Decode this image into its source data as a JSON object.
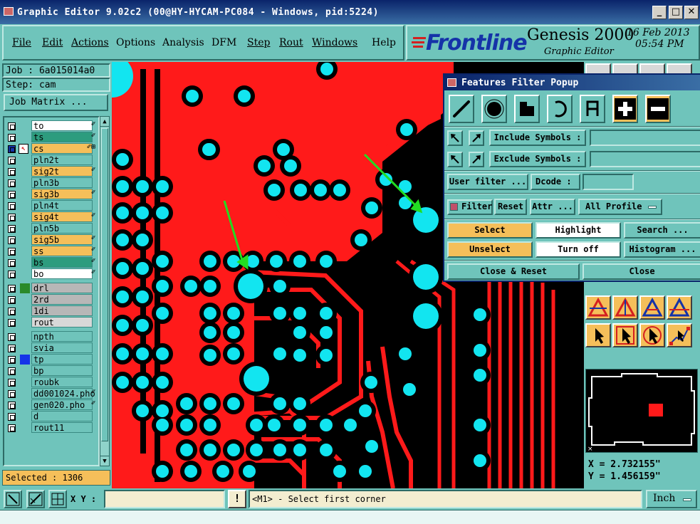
{
  "window": {
    "title": "Graphic Editor 9.02c2 (00@HY-HYCAM-PC084 - Windows, pid:5224)",
    "controls": {
      "minimize": "_",
      "maximize": "□",
      "close": "✕"
    }
  },
  "menu": {
    "items": [
      {
        "label": "File"
      },
      {
        "label": "Edit"
      },
      {
        "label": "Actions"
      },
      {
        "label": "Options"
      },
      {
        "label": "Analysis"
      },
      {
        "label": "DFM"
      },
      {
        "label": "Step"
      },
      {
        "label": "Rout"
      },
      {
        "label": "Windows"
      },
      {
        "label": "Help"
      }
    ]
  },
  "branding": {
    "logo": "Frontline",
    "product": "Genesis 2000",
    "subtitle": "Graphic Editor",
    "date": "16 Feb 2013",
    "time": "05:54 PM"
  },
  "left_panel": {
    "job": "Job : 6a015014a0",
    "step": "Step: cam",
    "job_matrix_button": "Job Matrix ...",
    "layers": [
      {
        "name": "to",
        "color": "#ffffff",
        "flag": "✐"
      },
      {
        "name": "ts",
        "color": "#2d9c7e",
        "flag": "✐"
      },
      {
        "name": "cs",
        "color": "#f5bf5a",
        "flag": "✐⊞"
      },
      {
        "name": "pln2t",
        "color": "#6fc4bb",
        "flag": ""
      },
      {
        "name": "sig2t",
        "color": "#f5bf5a",
        "flag": "✐"
      },
      {
        "name": "pln3b",
        "color": "#6fc4bb",
        "flag": ""
      },
      {
        "name": "sig3b",
        "color": "#f5bf5a",
        "flag": "✐"
      },
      {
        "name": "pln4t",
        "color": "#6fc4bb",
        "flag": ""
      },
      {
        "name": "sig4t",
        "color": "#f5bf5a",
        "flag": "✐"
      },
      {
        "name": "pln5b",
        "color": "#6fc4bb",
        "flag": ""
      },
      {
        "name": "sig5b",
        "color": "#f5bf5a",
        "flag": "✐"
      },
      {
        "name": "ss",
        "color": "#f5bf5a",
        "flag": "✐"
      },
      {
        "name": "bs",
        "color": "#2d9c7e",
        "flag": "✐"
      },
      {
        "name": "bo",
        "color": "#ffffff",
        "flag": "✐"
      },
      {
        "name": "drl",
        "color": "#b7b7b7",
        "flag": ""
      },
      {
        "name": "2rd",
        "color": "#b7b7b7",
        "flag": ""
      },
      {
        "name": "1di",
        "color": "#b7b7b7",
        "flag": ""
      },
      {
        "name": "rout",
        "color": "#d8d8d8",
        "flag": ""
      },
      {
        "name": "npth",
        "color": "#6fc4bb",
        "flag": ""
      },
      {
        "name": "svia",
        "color": "#6fc4bb",
        "flag": ""
      },
      {
        "name": "tp",
        "color": "#6fc4bb",
        "flag": ""
      },
      {
        "name": "bp",
        "color": "#6fc4bb",
        "flag": ""
      },
      {
        "name": "roubk",
        "color": "#6fc4bb",
        "flag": ""
      },
      {
        "name": "dd001024.pho",
        "color": "#6fc4bb",
        "flag": "✐"
      },
      {
        "name": "gen020.pho",
        "color": "#6fc4bb",
        "flag": "✐"
      },
      {
        "name": "d",
        "color": "#6fc4bb",
        "flag": ""
      },
      {
        "name": "rout11",
        "color": "#6fc4bb",
        "flag": ""
      }
    ],
    "selected_status": "Selected : 1306"
  },
  "popup": {
    "title": "Features Filter Popup",
    "include_symbols": "Include Symbols :",
    "exclude_symbols": "Exclude Symbols :",
    "user_filter": "User filter ...",
    "dcode": "Dcode :",
    "filter": "Filter",
    "reset": "Reset",
    "attr": "Attr ...",
    "all_profile": "All Profile",
    "select": "Select",
    "highlight": "Highlight",
    "search": "Search ...",
    "unselect": "Unselect",
    "turn_off": "Turn off",
    "histogram": "Histogram ...",
    "close_reset": "Close & Reset",
    "close": "Close"
  },
  "coords": {
    "x": "X = 2.732155\"",
    "y": "Y = 1.456159\""
  },
  "bottom": {
    "xy_label": "X Y :",
    "excl": "!",
    "prompt": "<M1> - Select first corner",
    "unit": "Inch"
  }
}
